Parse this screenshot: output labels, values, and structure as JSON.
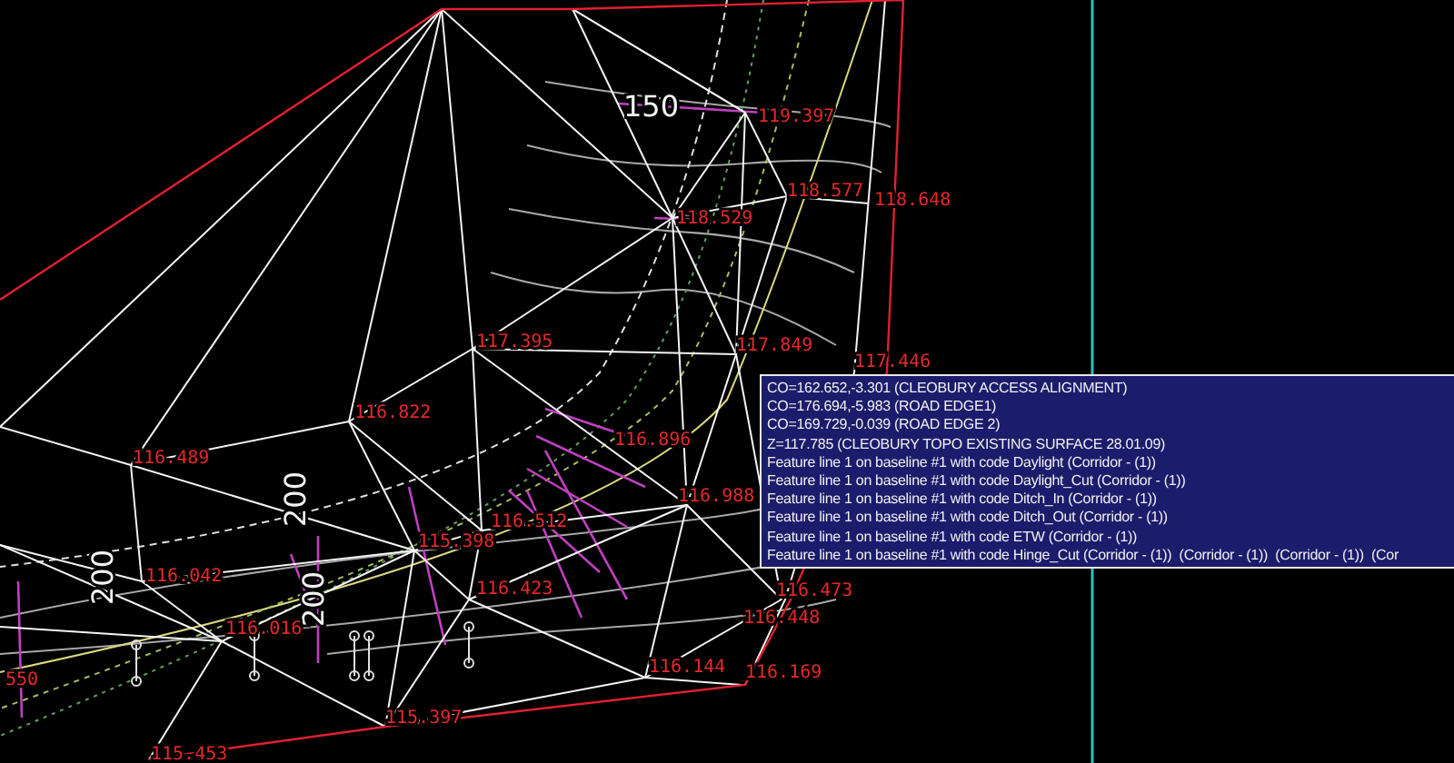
{
  "drawing": {
    "station_labels": [
      {
        "text": "150"
      },
      {
        "text": "200"
      },
      {
        "text": "200"
      },
      {
        "text": "200"
      }
    ],
    "elevation_labels": [
      {
        "text": "119.397"
      },
      {
        "text": "118.577"
      },
      {
        "text": "118.648"
      },
      {
        "text": "118.529"
      },
      {
        "text": "117.849"
      },
      {
        "text": "117.395"
      },
      {
        "text": "117.446"
      },
      {
        "text": "116.822"
      },
      {
        "text": "116.896"
      },
      {
        "text": "116.489"
      },
      {
        "text": "116.988"
      },
      {
        "text": "116.512"
      },
      {
        "text": "115.398"
      },
      {
        "text": "116.042"
      },
      {
        "text": "116.473"
      },
      {
        "text": "116.423"
      },
      {
        "text": "116.448"
      },
      {
        "text": "116.016"
      },
      {
        "text": "116.144"
      },
      {
        "text": "116.169"
      },
      {
        "text": "550"
      },
      {
        "text": "115.397"
      },
      {
        "text": "115.453"
      }
    ]
  },
  "tooltip": {
    "lines": [
      "CO=162.652,-3.301 (CLEOBURY ACCESS ALIGNMENT)",
      "CO=176.694,-5.983 (ROAD EDGE1)",
      "CO=169.729,-0.039 (ROAD EDGE 2)",
      "Z=117.785 (CLEOBURY TOPO EXISTING SURFACE 28.01.09)",
      "Feature line 1 on baseline #1 with code Daylight (Corridor - (1))",
      "Feature line 1 on baseline #1 with code Daylight_Cut (Corridor - (1))",
      "Feature line 1 on baseline #1 with code Ditch_In (Corridor - (1))",
      "Feature line 1 on baseline #1 with code Ditch_Out (Corridor - (1))",
      "Feature line 1 on baseline #1 with code ETW (Corridor - (1))",
      "Feature line 1 on baseline #1 with code Hinge_Cut (Corridor - (1))  (Corridor - (1))  (Corridor - (1))  (Cor"
    ]
  }
}
